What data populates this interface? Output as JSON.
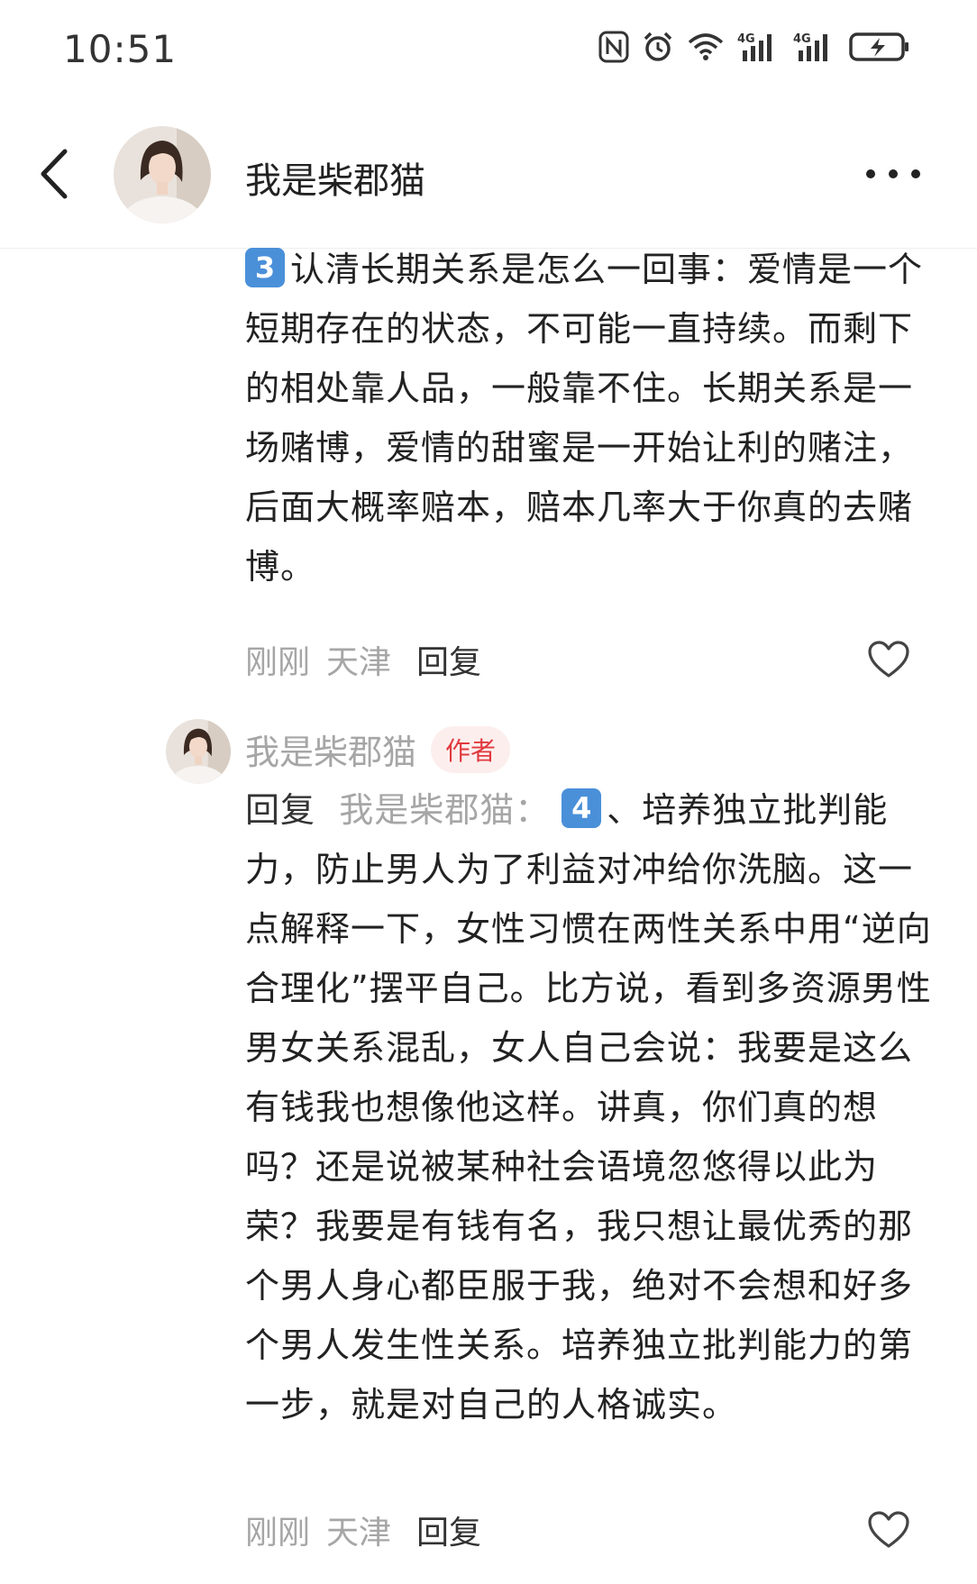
{
  "status_bar": {
    "time": "10:51",
    "icons": [
      "nfc-icon",
      "alarm-icon",
      "wifi-icon",
      "signal-4g-icon",
      "signal-4g-icon",
      "battery-charging-icon"
    ],
    "network_label_1": "4G",
    "network_label_2": "4G"
  },
  "header": {
    "title": "我是柴郡猫",
    "back_icon": "chevron-left-icon",
    "more_icon": "more-dots-icon"
  },
  "comment_1": {
    "badge": "3",
    "text": "认清长期关系是怎么一回事：爱情是一个短期存在的状态，不可能一直持续。而剩下的相处靠人品，一般靠不住。长期关系是一场赌博，爱情的甜蜜是一开始让利的赌注，后面大概率赔本，赔本几率大于你真的去赌博。",
    "time": "刚刚",
    "location": "天津",
    "reply_label": "回复"
  },
  "comment_2": {
    "author": "我是柴郡猫",
    "author_badge": "作者",
    "reply_prefix": "回复",
    "reply_target": "我是柴郡猫：",
    "badge": "4",
    "text": "、培养独立批判能力，防止男人为了利益对冲给你洗脑。这一点解释一下，女性习惯在两性关系中用“逆向合理化”摆平自己。比方说，看到多资源男性男女关系混乱，女人自己会说：我要是这么有钱我也想像他这样。讲真，你们真的想吗？还是说被某种社会语境忽悠得以此为荣？我要是有钱有名，我只想让最优秀的那个男人身心都臣服于我，绝对不会想和好多个男人发生性关系。培养独立批判能力的第一步，就是对自己的人格诚实。",
    "time": "刚刚",
    "location": "天津",
    "reply_label": "回复"
  },
  "colors": {
    "badge_blue": "#4a90d9",
    "author_badge_bg": "#fdeeee",
    "author_badge_text": "#e0393e",
    "meta_gray": "#a6a6a6"
  }
}
